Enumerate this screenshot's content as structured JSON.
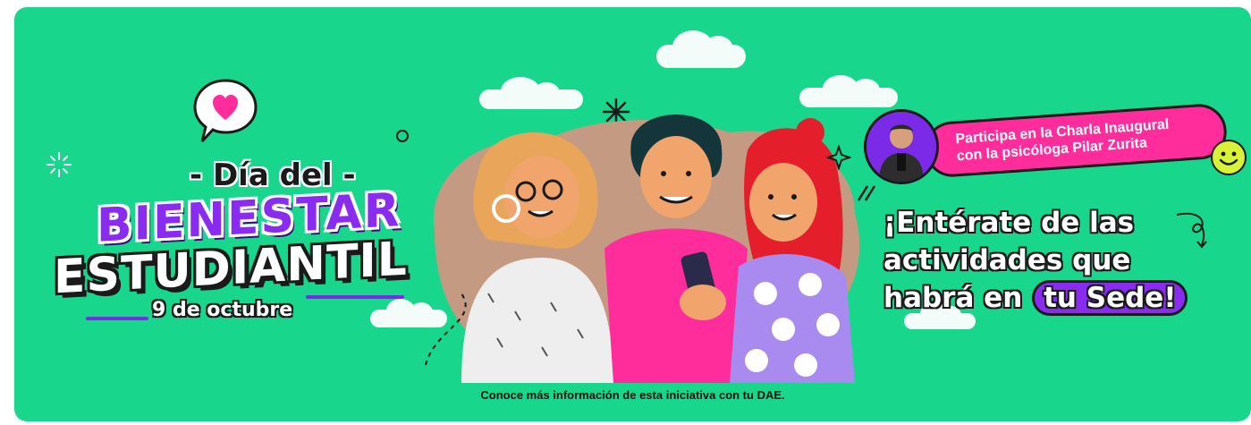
{
  "banner": {
    "title_small": "- Día del -",
    "title_big_1": "BIENESTAR",
    "title_big_2": "ESTUDIANTIL",
    "date": "9 de octubre",
    "charla_line1": "Participa en la Charla Inaugural",
    "charla_line2": "con la psicóloga Pilar Zurita",
    "headline_line1": "¡Entérate de las",
    "headline_line2": "actividades que",
    "headline_line3_prefix": "habrá en",
    "headline_line3_pill": "tu Sede!",
    "footer": "Conoce más información de esta iniciativa con tu DAE."
  },
  "colors": {
    "background": "#19d68d",
    "purple": "#8a2cf0",
    "pink": "#ff2d9b",
    "yellow": "#d8f23a",
    "skin": "#f2a46d",
    "brown_blob": "#c49a82"
  },
  "icons": {
    "speech_heart": "heart-speech-bubble-icon",
    "smiley": "smiley-face-icon",
    "sparkle": "sparkle-icon",
    "asterisk": "asterisk-icon"
  }
}
